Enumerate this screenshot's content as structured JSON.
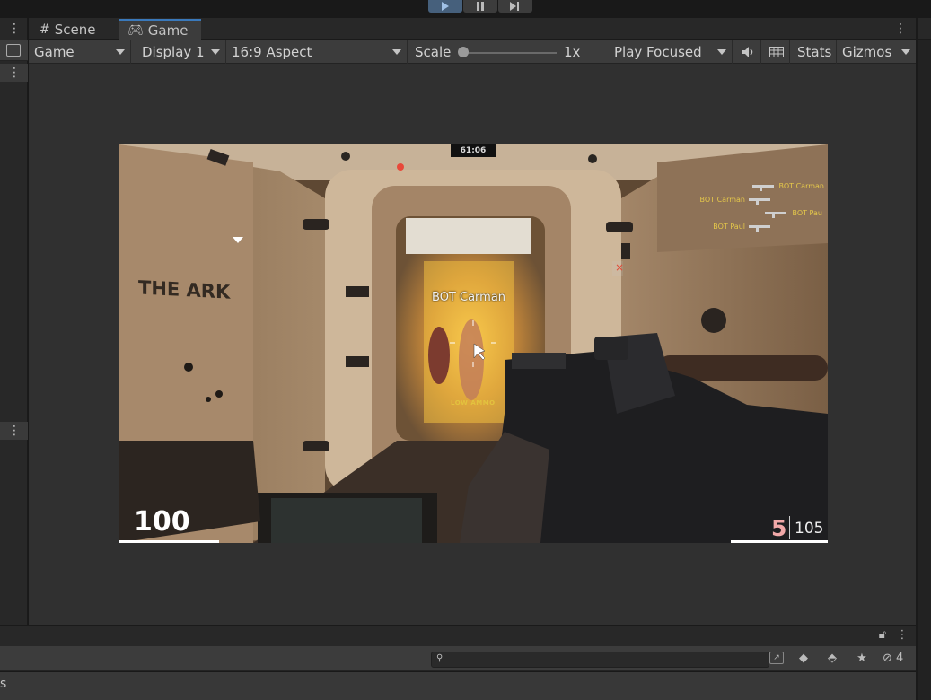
{
  "play_controls": {
    "play": "play-icon",
    "pause": "pause-icon",
    "step": "step-icon",
    "accent": "#46607c"
  },
  "tabs": [
    {
      "label": "Scene",
      "icon": "grid-icon",
      "active": false
    },
    {
      "label": "Game",
      "icon": "gamepad-icon",
      "active": true
    }
  ],
  "toolbar": {
    "display_mode": "Game",
    "display": "Display 1",
    "aspect": "16:9 Aspect",
    "scale_label": "Scale",
    "scale_value": "1x",
    "scale_slider_fraction": 0.0,
    "play_mode": "Play Focused",
    "stats": "Stats",
    "gizmos": "Gizmos"
  },
  "game": {
    "timer": "61:06",
    "wall_text": "THE ARK",
    "target_name": "BOT Carman",
    "low_ammo": "LOW AMMO",
    "health": "100",
    "ammo_clip": "5",
    "ammo_reserve": "105",
    "killfeed": [
      {
        "left": "",
        "right": "BOT Carman"
      },
      {
        "left": "BOT Carman",
        "right": ""
      },
      {
        "left": "",
        "right": "BOT Pau"
      },
      {
        "left": "BOT Paul",
        "right": ""
      }
    ],
    "colors": {
      "hud_yellow": "#e5c84a",
      "ammo_pink": "#f1a8a8"
    }
  },
  "bottom": {
    "hidden_count": "4",
    "partial_label": "s"
  }
}
